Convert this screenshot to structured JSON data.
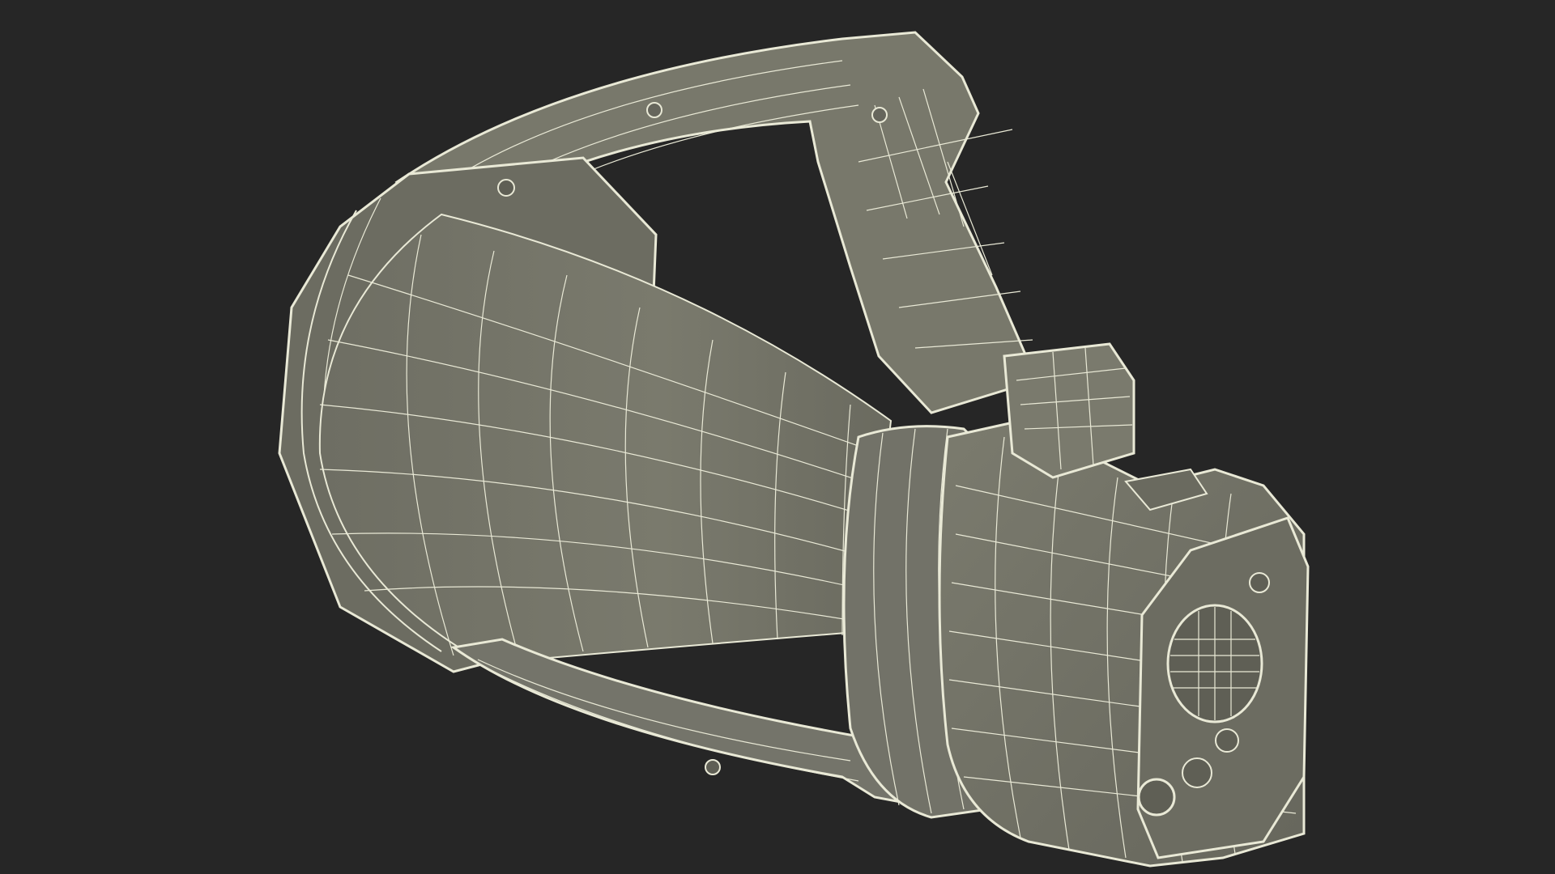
{
  "scene": {
    "subject": "megaphone-wireframe-model",
    "background_color": "#262626",
    "surface_color": "#76766a",
    "surface_shade_color": "#5f5f55",
    "wire_color": "#e9e9d6"
  }
}
